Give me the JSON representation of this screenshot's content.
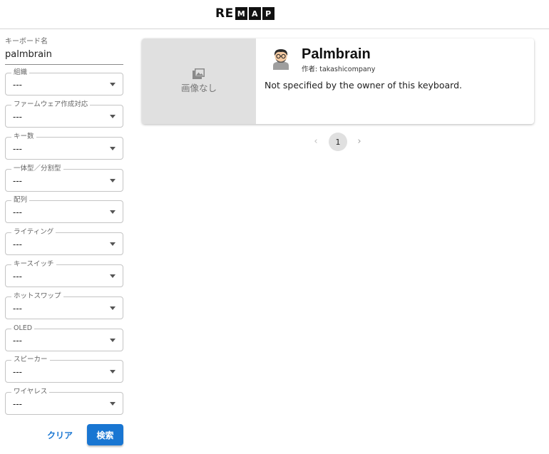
{
  "header": {
    "logo_text": "RE",
    "logo_boxes": [
      "M",
      "A",
      "P"
    ]
  },
  "search": {
    "keyboard_name_label": "キーボード名",
    "keyboard_name_value": "palmbrain",
    "filters": [
      {
        "label": "組織",
        "value": "---"
      },
      {
        "label": "ファームウェア作成対応",
        "value": "---"
      },
      {
        "label": "キー数",
        "value": "---"
      },
      {
        "label": "一体型／分割型",
        "value": "---"
      },
      {
        "label": "配列",
        "value": "---"
      },
      {
        "label": "ライティング",
        "value": "---"
      },
      {
        "label": "キースイッチ",
        "value": "---"
      },
      {
        "label": "ホットスワップ",
        "value": "---"
      },
      {
        "label": "OLED",
        "value": "---"
      },
      {
        "label": "スピーカー",
        "value": "---"
      },
      {
        "label": "ワイヤレス",
        "value": "---"
      }
    ],
    "clear_label": "クリア",
    "search_label": "検索"
  },
  "results": [
    {
      "no_image_label": "画像なし",
      "name": "Palmbrain",
      "author": "作者: takashicompany",
      "description": "Not specified by the owner of this keyboard."
    }
  ],
  "pagination": {
    "current_page": "1",
    "prev_icon": "chevron-left-icon",
    "next_icon": "chevron-right-icon"
  },
  "colors": {
    "primary": "#1976d2",
    "thumb_bg": "#e0e0e0"
  }
}
